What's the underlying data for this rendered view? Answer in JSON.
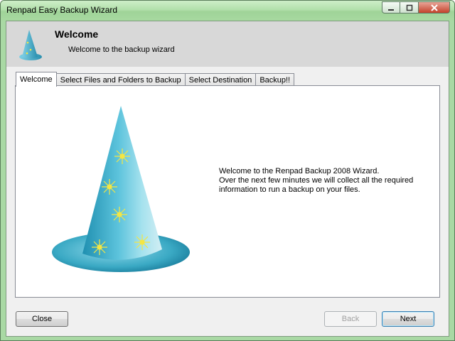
{
  "window": {
    "title": "Renpad Easy Backup Wizard"
  },
  "header": {
    "title": "Welcome",
    "subtitle": "Welcome to the backup wizard"
  },
  "tabs": [
    {
      "label": "Welcome",
      "active": true
    },
    {
      "label": "Select Files and Folders to Backup",
      "active": false
    },
    {
      "label": "Select Destination",
      "active": false
    },
    {
      "label": "Backup!!",
      "active": false
    }
  ],
  "content": {
    "lines": [
      "Welcome to the Renpad Backup 2008 Wizard.",
      "Over the next few minutes we will collect all the required",
      "information to run a backup on your files."
    ]
  },
  "buttons": {
    "close": "Close",
    "back": "Back",
    "next": "Next",
    "back_enabled": false
  },
  "icons": {
    "window_controls": [
      "minimize-icon",
      "maximize-icon",
      "close-icon"
    ],
    "wizard": "wizard-hat-icon"
  },
  "colors": {
    "chrome": "#a9d9a4",
    "hat": "#3aa9c4",
    "stars": "#f5e642"
  }
}
